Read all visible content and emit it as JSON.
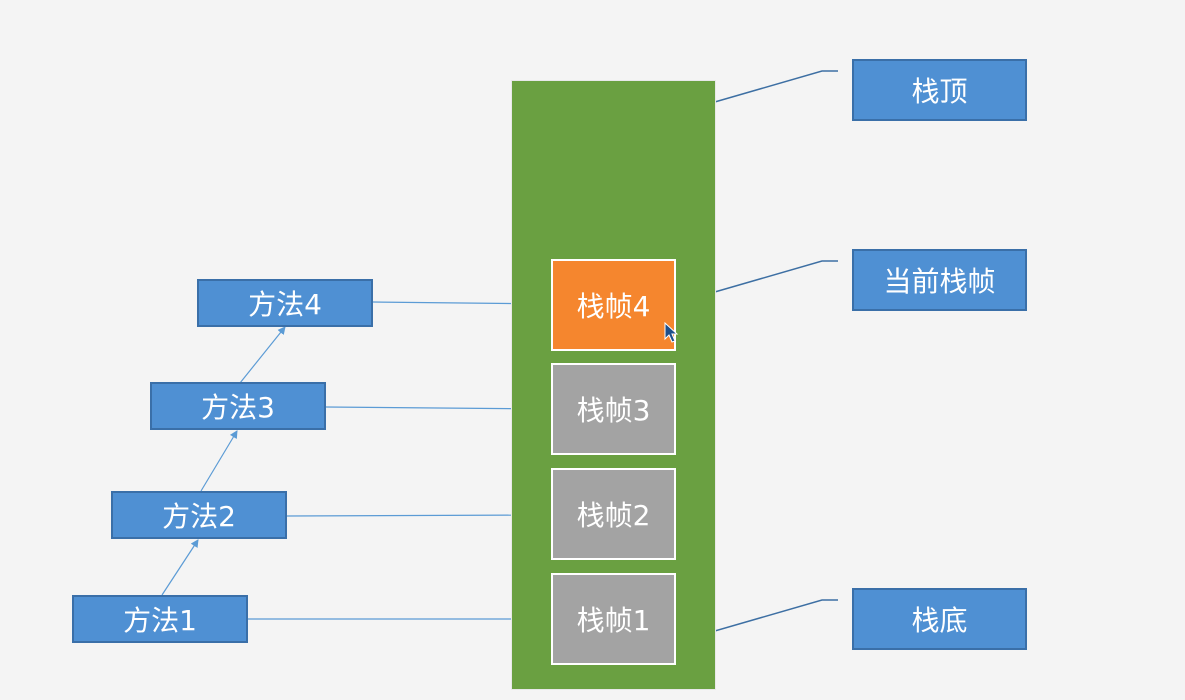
{
  "colors": {
    "background": "#f4f4f4",
    "stack": "#6aa041",
    "method_box": "#4f90d3",
    "current_frame": "#f5862e",
    "frame": "#a3a3a3",
    "connector": "#3d6fa3"
  },
  "methods": [
    "方法1",
    "方法2",
    "方法3",
    "方法4"
  ],
  "frames": [
    "栈帧1",
    "栈帧2",
    "栈帧3",
    "栈帧4"
  ],
  "current_frame": "栈帧4",
  "labels": {
    "top": "栈顶",
    "current": "当前栈帧",
    "bottom": "栈底"
  },
  "icons": [
    "mouse-cursor-icon"
  ]
}
